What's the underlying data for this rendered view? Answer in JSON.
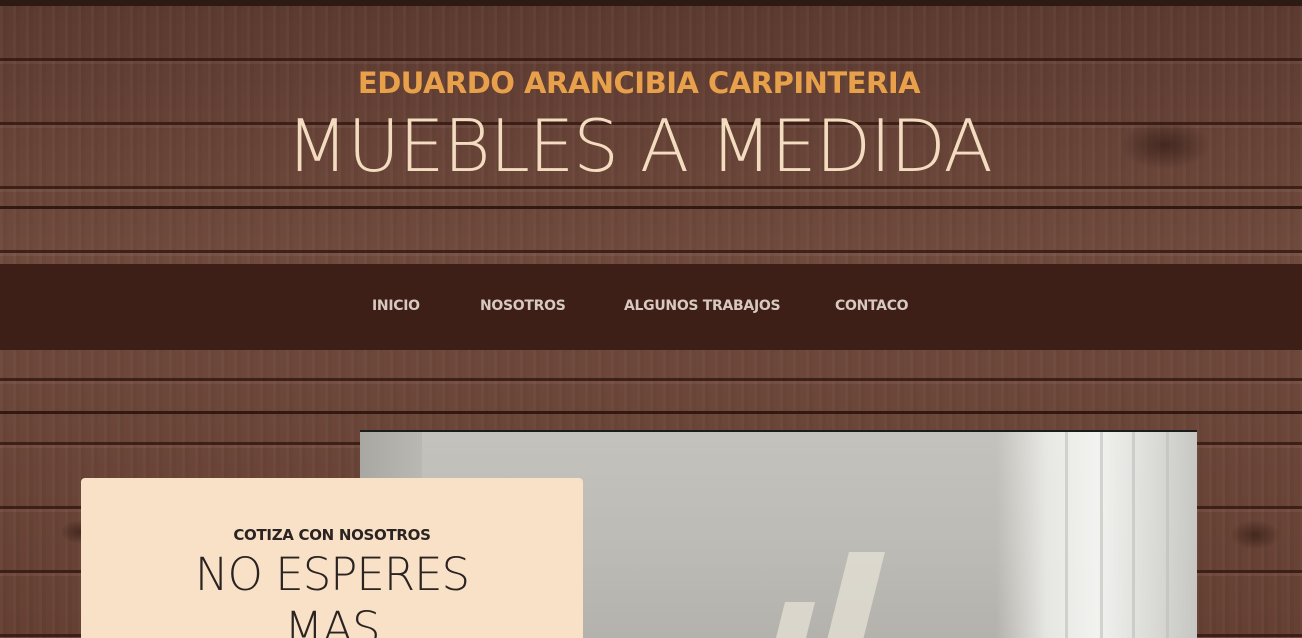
{
  "header": {
    "brand": "EDUARDO ARANCIBIA CARPINTERIA",
    "tagline": "MUEBLES A MEDIDA"
  },
  "nav": {
    "items": [
      {
        "label": "INICIO"
      },
      {
        "label": "NOSOTROS"
      },
      {
        "label": "ALGUNOS TRABAJOS"
      },
      {
        "label": "CONTACO"
      }
    ]
  },
  "cta": {
    "kicker": "COTIZA CON NOSOTROS",
    "title": "NO ESPERES MAS"
  },
  "colors": {
    "brand": "#e8a04a",
    "tagline": "#f3dcc0",
    "navbar_bg": "#3d1f18",
    "nav_text": "#d8c9c0",
    "cta_bg": "#f8e1c6",
    "cta_text": "#2a2322",
    "wood": "#6a4438"
  }
}
